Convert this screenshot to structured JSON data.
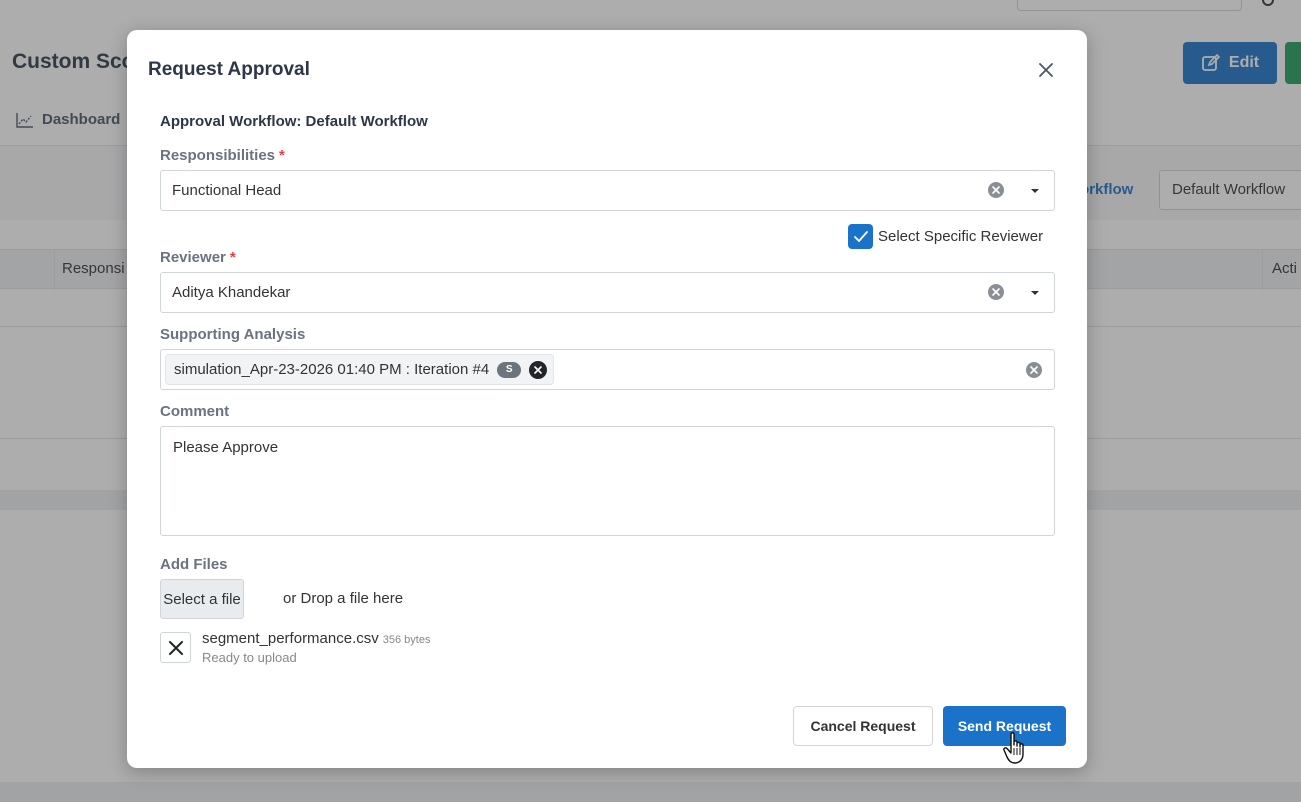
{
  "background": {
    "page_title": "Custom Sco",
    "edit_label": "Edit",
    "tab_dashboard": "Dashboard",
    "workflow_link": "orkflow",
    "workflow_select": "Default Workflow",
    "col_responsibility": "Responsi",
    "col_action": "Acti"
  },
  "modal": {
    "title": "Request Approval",
    "workflow_heading": "Approval Workflow: Default Workflow",
    "responsibilities": {
      "label": "Responsibilities",
      "required_mark": "*",
      "value": "Functional Head"
    },
    "specific_reviewer": {
      "label": "Select Specific Reviewer",
      "checked": true
    },
    "reviewer": {
      "label": "Reviewer",
      "required_mark": "*",
      "value": "Aditya Khandekar"
    },
    "supporting_analysis": {
      "label": "Supporting Analysis",
      "tags": [
        {
          "text": "simulation_Apr-23-2026 01:40 PM : Iteration #4",
          "badge": "S"
        }
      ]
    },
    "comment": {
      "label": "Comment",
      "value": "Please Approve"
    },
    "add_files": {
      "label": "Add Files",
      "select_button": "Select a file",
      "drop_text": "or Drop a file here",
      "files": [
        {
          "name": "segment_performance.csv",
          "size": "356 bytes",
          "status": "Ready to upload"
        }
      ]
    },
    "buttons": {
      "cancel": "Cancel Request",
      "send": "Send Request"
    }
  },
  "colors": {
    "primary": "#1a73c8",
    "success": "#1e9e5a",
    "required": "#e53e3e"
  }
}
